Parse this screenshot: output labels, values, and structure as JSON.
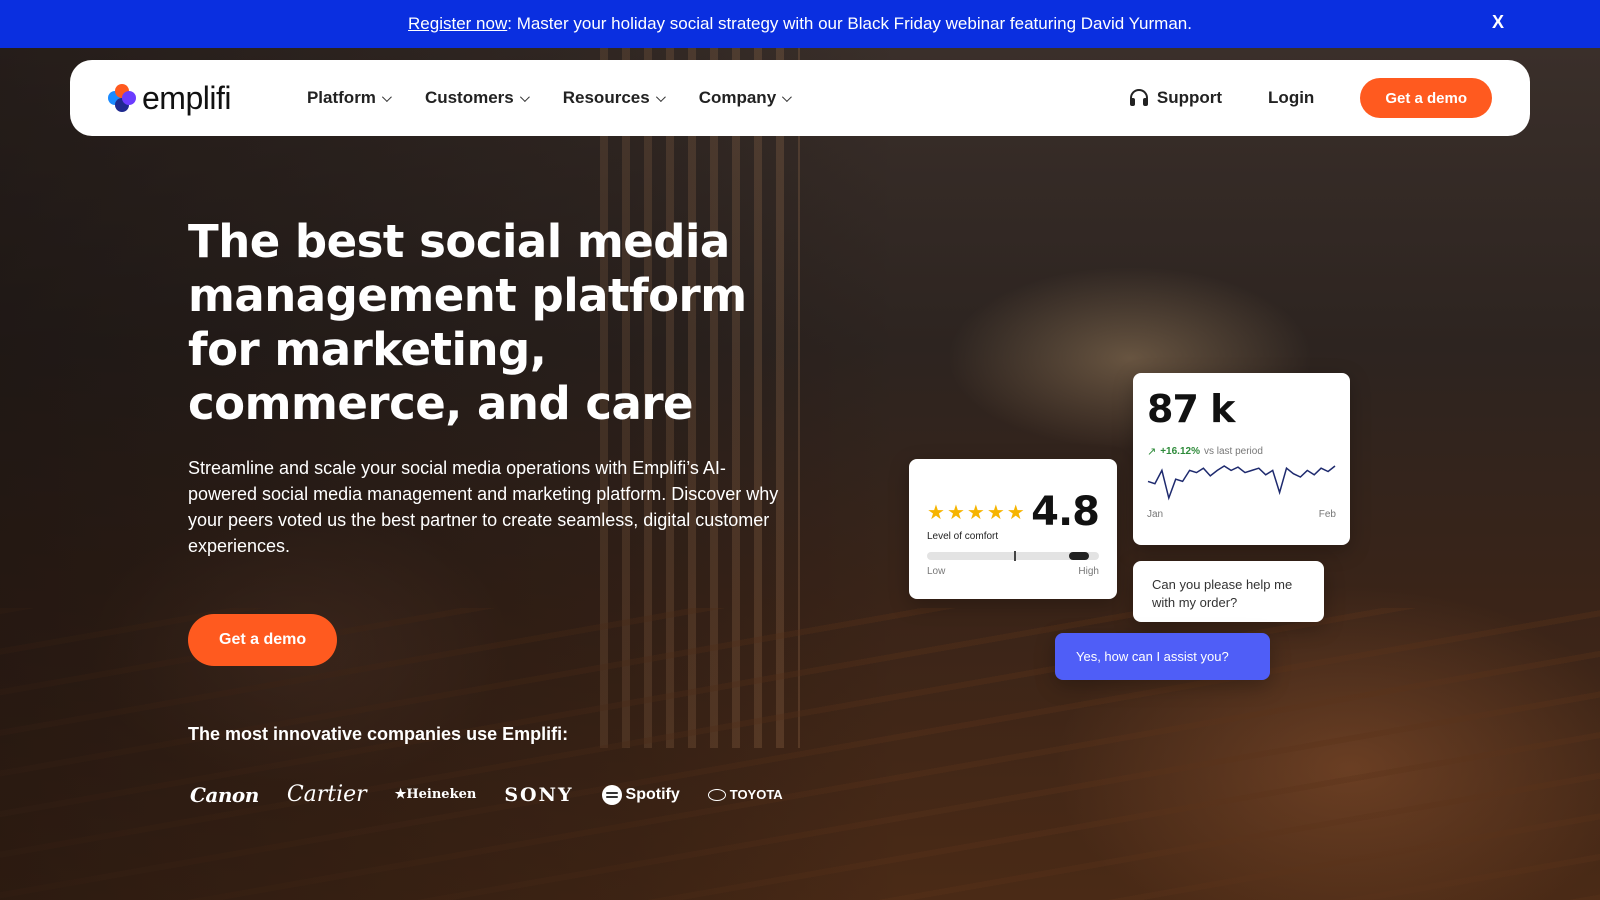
{
  "announcement": {
    "link_text": "Register now",
    "message": ": Master your holiday social strategy with our Black Friday webinar featuring David Yurman.",
    "close_label": "X"
  },
  "nav": {
    "logo_text": "emplifi",
    "menu": [
      {
        "label": "Platform"
      },
      {
        "label": "Customers"
      },
      {
        "label": "Resources"
      },
      {
        "label": "Company"
      }
    ],
    "support_label": "Support",
    "login_label": "Login",
    "demo_label": "Get a demo"
  },
  "hero": {
    "title": "The best social media management platform for marketing, commerce, and care",
    "subtitle": "Streamline and scale your social media operations with Emplifi’s AI-powered social media management and marketing platform. Discover why your peers voted us the best partner to create seamless, digital customer experiences.",
    "cta_label": "Get a demo",
    "logos_title": "The most innovative companies use Emplifi:",
    "brands": [
      "Canon",
      "Cartier",
      "Heineken",
      "SONY",
      "Spotify",
      "TOYOTA"
    ]
  },
  "rating_card": {
    "stars": 5,
    "value": "4.8",
    "label": "Level of comfort",
    "low_label": "Low",
    "high_label": "High",
    "level": 0.94
  },
  "stat_card": {
    "value": "87 k",
    "change": "+16.12%",
    "change_suffix": "vs last period",
    "start_label": "Jan",
    "end_label": "Feb",
    "sparkline": [
      40,
      42,
      30,
      55,
      38,
      40,
      30,
      32,
      28,
      35,
      30,
      26,
      30,
      27,
      32,
      30,
      28,
      34,
      30,
      50,
      28,
      33,
      36,
      30,
      34,
      28,
      31,
      26
    ]
  },
  "chat": {
    "question": "Can you please help me with my order?",
    "answer": "Yes, how can I assist you?"
  },
  "colors": {
    "announce_bg": "#0a2fe0",
    "accent": "#ff5a1f",
    "chat_blue": "#4f5ef7",
    "star": "#f6b400",
    "positive": "#2e8b3a"
  }
}
